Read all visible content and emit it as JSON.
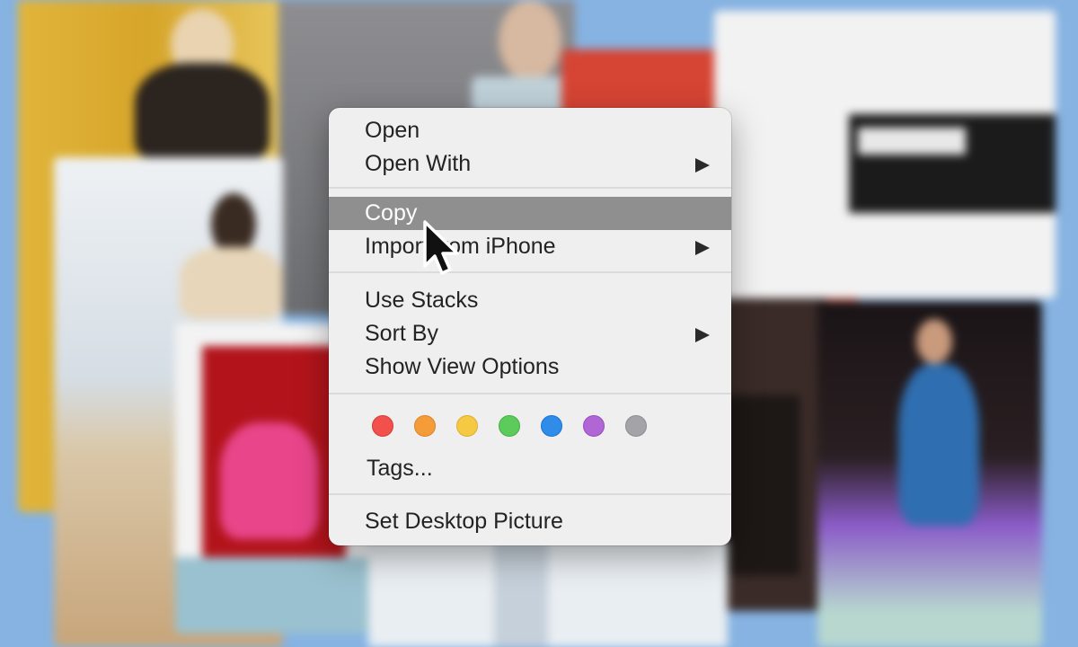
{
  "context_menu": {
    "group_open": {
      "open_label": "Open",
      "open_with_label": "Open With"
    },
    "group_edit": {
      "copy_label": "Copy",
      "import_label": "Import from iPhone"
    },
    "group_view": {
      "use_stacks_label": "Use Stacks",
      "sort_by_label": "Sort By",
      "view_options_label": "Show View Options"
    },
    "tags": {
      "colors": [
        {
          "name": "red",
          "fill": "#f2504c",
          "stroke": "#d83a36"
        },
        {
          "name": "orange",
          "fill": "#f59c3a",
          "stroke": "#dc8324"
        },
        {
          "name": "yellow",
          "fill": "#f6c945",
          "stroke": "#dcae2d"
        },
        {
          "name": "green",
          "fill": "#5ccb5c",
          "stroke": "#43b043"
        },
        {
          "name": "blue",
          "fill": "#2f8ce9",
          "stroke": "#1c73cf"
        },
        {
          "name": "purple",
          "fill": "#b166d6",
          "stroke": "#974dbd"
        },
        {
          "name": "gray",
          "fill": "#a3a3a8",
          "stroke": "#8b8b90"
        }
      ],
      "tags_label": "Tags..."
    },
    "set_desktop_label": "Set Desktop Picture",
    "highlight_color": "#8f8f8f"
  }
}
